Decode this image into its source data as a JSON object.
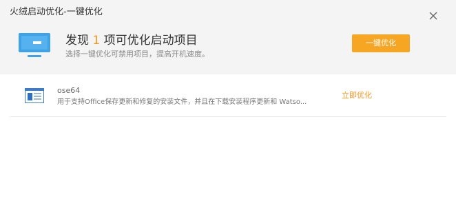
{
  "window": {
    "title": "火绒启动优化-一键优化",
    "close_icon": "close-icon"
  },
  "summary": {
    "headline_prefix": "发现 ",
    "count": "1",
    "headline_suffix": " 项可优化启动项目",
    "subtext": "选择一键优化可禁用项目，提高开机速度。",
    "optimize_all_label": "一键优化",
    "icon": "monitor-icon",
    "colors": {
      "accent": "#f7931e",
      "button": "#f6a623",
      "monitor": "#3ea3e6"
    }
  },
  "items": [
    {
      "name": "ose64",
      "description": "用于支持Office保存更新和修复的安装文件，并且在下载安装程序更新和 Watso...",
      "action_label": "立即优化",
      "icon": "window-app-icon"
    }
  ]
}
